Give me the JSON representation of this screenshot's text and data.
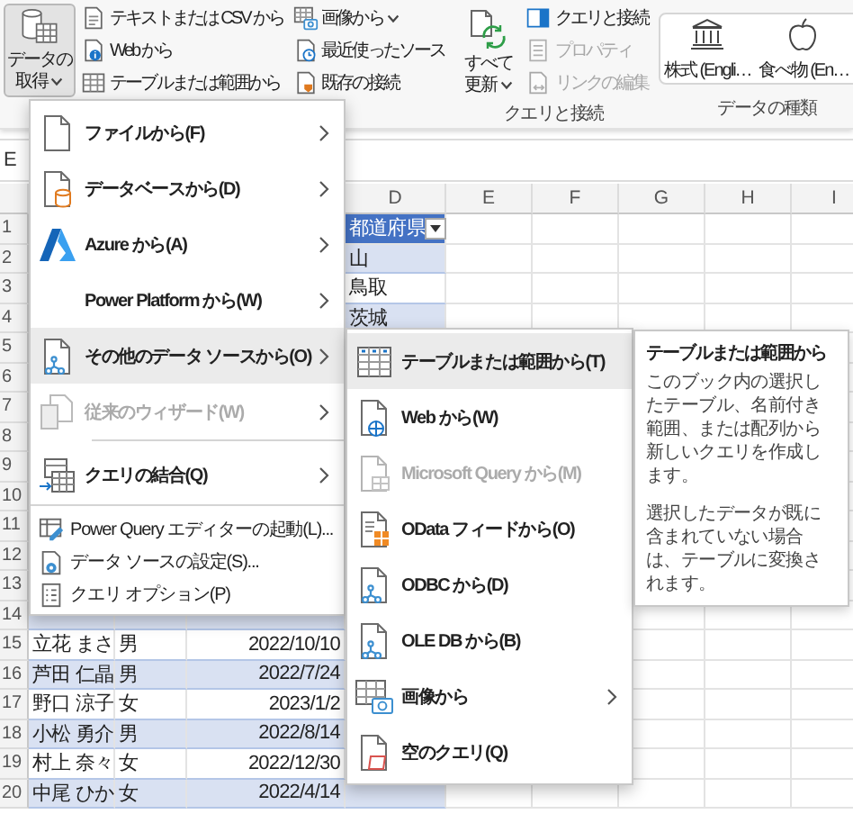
{
  "ribbon": {
    "get_data": {
      "label": [
        "データの",
        "取得"
      ],
      "selected": true
    },
    "import_buttons": [
      {
        "label": "テキストまたは CSV から",
        "dropdown": false
      },
      {
        "label": "Web から",
        "dropdown": false
      },
      {
        "label": "テーブルまたは範囲から",
        "dropdown": false
      },
      {
        "label": "画像から",
        "dropdown": true
      },
      {
        "label": "最近使ったソース",
        "dropdown": false
      },
      {
        "label": "既存の接続",
        "dropdown": false
      }
    ],
    "refresh_all": {
      "label": [
        "すべて",
        "更新"
      ]
    },
    "query_buttons": [
      {
        "label": "クエリと接続",
        "disabled": false
      },
      {
        "label": "プロパティ",
        "disabled": true
      },
      {
        "label": "リンクの編集",
        "disabled": true
      }
    ],
    "query_group_label": "クエリと接続",
    "data_types": [
      {
        "label": "株式 (Engli…"
      },
      {
        "label": "食べ物 (En…"
      }
    ],
    "data_types_group_label": "データの種類"
  },
  "name_box": "E",
  "columns": [
    "D",
    "E",
    "F",
    "G",
    "H",
    "I"
  ],
  "rows": [
    {
      "number": "1",
      "kind": "header",
      "column_4": "都道府県"
    },
    {
      "number": "2",
      "kind": "data",
      "column_4": "山"
    },
    {
      "number": "3",
      "kind": "data",
      "column_4": "鳥取"
    },
    {
      "number": "4",
      "kind": "data",
      "column_4": "茨城"
    },
    {
      "number": "5",
      "kind": "data"
    },
    {
      "number": "6",
      "kind": "data"
    },
    {
      "number": "7",
      "kind": "data"
    },
    {
      "number": "8",
      "kind": "data"
    },
    {
      "number": "9",
      "kind": "data"
    },
    {
      "number": "10",
      "kind": "data"
    },
    {
      "number": "11",
      "kind": "data"
    },
    {
      "number": "12",
      "kind": "data"
    },
    {
      "number": "13",
      "kind": "data"
    },
    {
      "number": "14",
      "kind": "data"
    },
    {
      "number": "15",
      "kind": "data",
      "column_1": "立花 まさ",
      "column_2": "男",
      "column_3": "2022/10/10"
    },
    {
      "number": "16",
      "kind": "data",
      "column_1": "芦田 仁晶",
      "column_2": "男",
      "column_3": "2022/7/24"
    },
    {
      "number": "17",
      "kind": "data",
      "column_1": "野口 涼子",
      "column_2": "女",
      "column_3": "2023/1/2"
    },
    {
      "number": "18",
      "kind": "data",
      "column_1": "小松 勇介",
      "column_2": "男",
      "column_3": "2022/8/14"
    },
    {
      "number": "19",
      "kind": "data",
      "column_1": "村上 奈々",
      "column_2": "女",
      "column_3": "2022/12/30"
    },
    {
      "number": "20",
      "kind": "data",
      "column_1": "中尾 ひか",
      "column_2": "女",
      "column_3": "2022/4/14"
    }
  ],
  "get_data_menu": [
    {
      "kind": "large",
      "label": "ファイルから(F)",
      "submenu": true,
      "selected": false,
      "disabled": false,
      "divider_above": false
    },
    {
      "kind": "large",
      "label": "データベースから(D)",
      "submenu": true,
      "selected": false,
      "disabled": false,
      "divider_above": false
    },
    {
      "kind": "large",
      "label": "Azure から(A)",
      "submenu": true,
      "selected": false,
      "disabled": false,
      "divider_above": false
    },
    {
      "kind": "large",
      "label": "Power Platform から(W)",
      "submenu": true,
      "selected": false,
      "disabled": false,
      "divider_above": false
    },
    {
      "kind": "large",
      "label": "その他のデータ ソースから(O)",
      "submenu": true,
      "selected": true,
      "disabled": false,
      "divider_above": false
    },
    {
      "kind": "large",
      "label": "従来のウィザード(W)",
      "submenu": true,
      "selected": false,
      "disabled": true,
      "divider_above": false
    },
    {
      "kind": "large",
      "label": "クエリの結合(Q)",
      "submenu": true,
      "selected": false,
      "disabled": false,
      "divider_above": true
    },
    {
      "kind": "small",
      "label": "Power Query エディターの起動(L)...",
      "submenu": false,
      "selected": false,
      "disabled": false,
      "divider_above": true
    },
    {
      "kind": "small",
      "label": "データ ソースの設定(S)...",
      "submenu": false,
      "selected": false,
      "disabled": false,
      "divider_above": false
    },
    {
      "kind": "small",
      "label": "クエリ オプション(P)",
      "submenu": false,
      "selected": false,
      "disabled": false,
      "divider_above": false
    }
  ],
  "other_sources_menu": [
    {
      "label": "テーブルまたは範囲から(T)",
      "submenu": false,
      "selected": true,
      "disabled": false
    },
    {
      "label": "Web から(W)",
      "submenu": false,
      "selected": false,
      "disabled": false
    },
    {
      "label": "Microsoft Query から(M)",
      "submenu": false,
      "selected": false,
      "disabled": true
    },
    {
      "label": "OData フィードから(O)",
      "submenu": false,
      "selected": false,
      "disabled": false
    },
    {
      "label": "ODBC から(D)",
      "submenu": false,
      "selected": false,
      "disabled": false
    },
    {
      "label": "OLE DB から(B)",
      "submenu": false,
      "selected": false,
      "disabled": false
    },
    {
      "label": "画像から",
      "submenu": true,
      "selected": false,
      "disabled": false
    },
    {
      "label": "空のクエリ(Q)",
      "submenu": false,
      "selected": false,
      "disabled": false
    }
  ],
  "tooltip": {
    "title": "テーブルまたは範囲から",
    "paragraphs": [
      "このブック内の選択したテーブル、名前付き範囲、または配列から新しいクエリを作成します。",
      "選択したデータが既に含まれていない場合は、テーブルに変換されます。"
    ]
  }
}
